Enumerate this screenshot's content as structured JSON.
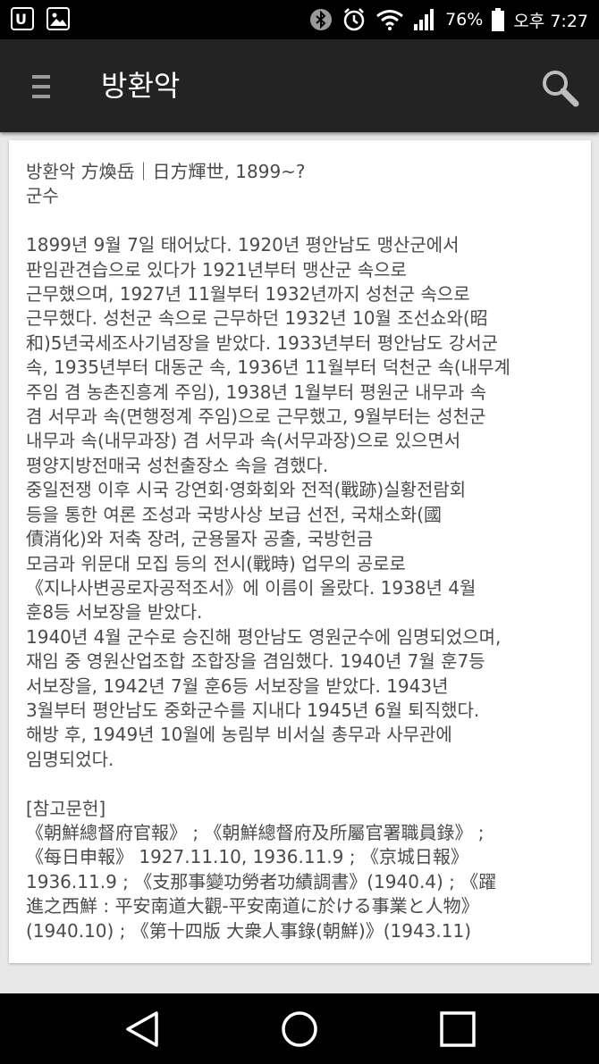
{
  "status_bar": {
    "icons_left": [
      "uplus-icon",
      "gallery-icon"
    ],
    "icons_right": [
      "bluetooth-icon",
      "alarm-icon",
      "wifi-icon",
      "signal-icon"
    ],
    "battery_percent": "76%",
    "time": "오후 7:27"
  },
  "app_bar": {
    "title": "방환악",
    "menu_icon": "hamburger-menu-icon",
    "search_icon": "search-icon"
  },
  "article": {
    "header": "방환악 方煥岳｜日方輝世, 1899~?",
    "position": "군수",
    "body_lines": [
      "1899년 9월 7일 태어났다. 1920년 평안남도 맹산군에서",
      "판임관견습으로 있다가 1921년부터 맹산군 속으로",
      "근무했으며, 1927년 11월부터 1932년까지 성천군 속으로",
      "근무했다. 성천군 속으로 근무하던 1932년 10월 조선쇼와(昭",
      "和)5년국세조사기념장을 받았다. 1933년부터 평안남도 강서군",
      "속, 1935년부터 대동군 속, 1936년 11월부터 덕천군 속(내무계",
      "주임 겸 농촌진흥계 주임), 1938년 1월부터 평원군 내무과 속",
      "겸 서무과 속(면행정계 주임)으로 근무했고, 9월부터는 성천군",
      "내무과 속(내무과장) 겸 서무과 속(서무과장)으로 있으면서",
      "평양지방전매국 성천출장소 속을 겸했다.",
      "중일전쟁 이후 시국 강연회·영화회와 전적(戰跡)실황전람회",
      "등을 통한 여론 조성과 국방사상 보급 선전, 국채소화(國",
      "債消化)와 저축 장려, 군용물자 공출, 국방헌금",
      "모금과 위문대 모집 등의 전시(戰時) 업무의 공로로",
      "《지나사변공로자공적조서》에 이름이 올랐다. 1938년 4월",
      "훈8등 서보장을 받았다.",
      "1940년 4월 군수로 승진해 평안남도 영원군수에 임명되었으며,",
      "재임 중 영원산업조합 조합장을 겸임했다. 1940년 7월 훈7등",
      "서보장을, 1942년 7월 훈6등 서보장을 받았다. 1943년",
      "3월부터 평안남도 중화군수를 지내다 1945년 6월 퇴직했다.",
      "해방 후, 1949년 10월에 농림부 비서실 총무과 사무관에",
      "임명되었다."
    ],
    "references_heading": "[참고문헌]",
    "references_lines": [
      "《朝鮮總督府官報》 ; 《朝鮮總督府及所屬官署職員錄》 ;",
      "《每日申報》 1927.11.10, 1936.11.9 ; 《京城日報》",
      "1936.11.9 ; 《支那事變功勞者功績調書》(1940.4) ; 《躍",
      "進之西鮮 : 平安南道大觀-平安南道に於ける事業と人物》",
      "(1940.10) ; 《第十四版 大衆人事錄(朝鮮)》(1943.11)"
    ]
  },
  "nav_bar": {
    "buttons": [
      "back-icon",
      "home-icon",
      "recents-icon"
    ]
  }
}
